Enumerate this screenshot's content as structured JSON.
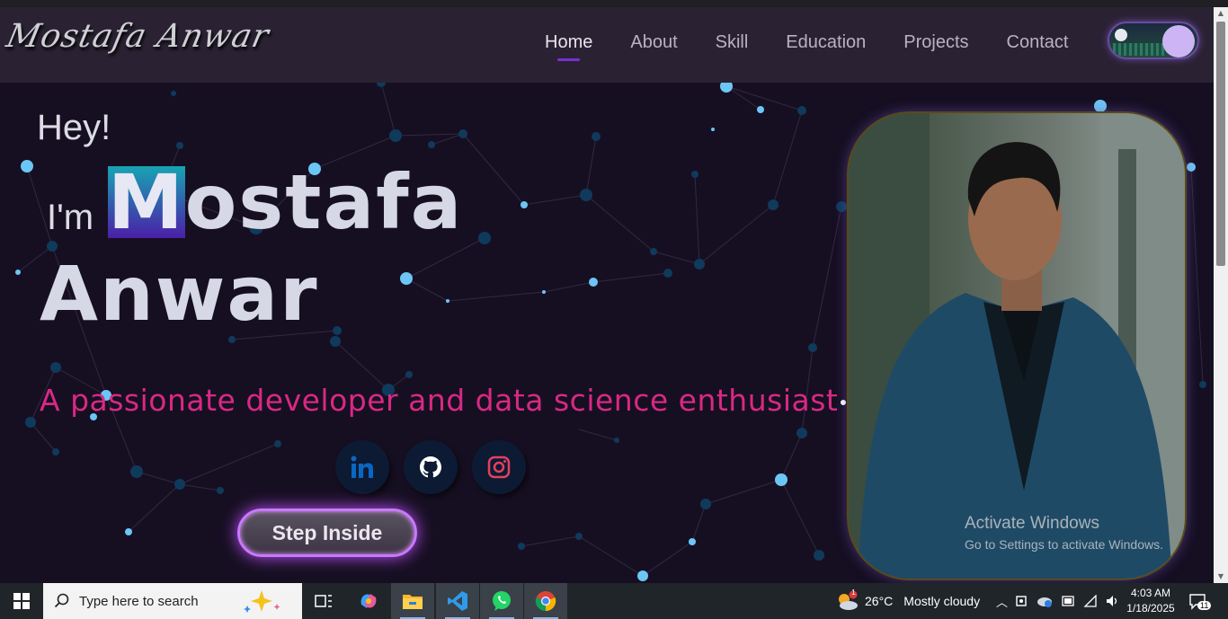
{
  "site": {
    "logo": "Mostafa Anwar",
    "nav": [
      {
        "label": "Home",
        "active": true
      },
      {
        "label": "About",
        "active": false
      },
      {
        "label": "Skill",
        "active": false
      },
      {
        "label": "Education",
        "active": false
      },
      {
        "label": "Projects",
        "active": false
      },
      {
        "label": "Contact",
        "active": false
      }
    ],
    "theme_toggle_icon": "night-scene-toggle",
    "accent_color": "#7a2fd0"
  },
  "hero": {
    "greeting": "Hey!",
    "im": "I'm",
    "first_name_highlight": "M",
    "first_name_rest": "ostafa",
    "last_name": "Anwar",
    "tagline": "A passionate developer and  data  science enthusiast",
    "tagline_color": "#d92884",
    "socials": [
      {
        "name": "linkedin-icon"
      },
      {
        "name": "github-icon"
      },
      {
        "name": "instagram-icon"
      }
    ],
    "cta_label": "Step Inside"
  },
  "watermark": {
    "line1": "Activate Windows",
    "line2": "Go to Settings to activate Windows."
  },
  "taskbar": {
    "search_placeholder": "Type here to search",
    "weather_temp": "26°C",
    "weather_text": "Mostly cloudy",
    "time": "4:03 AM",
    "date": "1/18/2025",
    "notification_count": "11",
    "weather_badge": "1"
  }
}
